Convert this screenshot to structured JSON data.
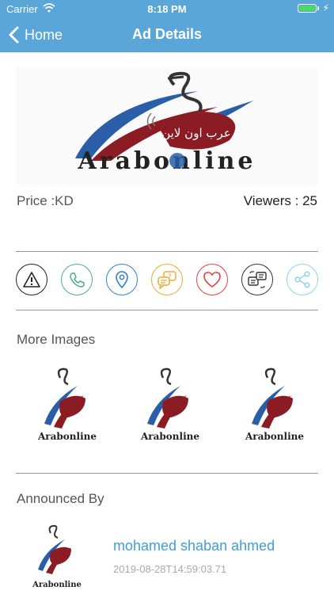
{
  "status_bar": {
    "carrier": "Carrier",
    "time": "8:18 PM"
  },
  "nav": {
    "back_label": "Home",
    "title": "Ad Details"
  },
  "ad": {
    "price_label": "Price :KD",
    "viewers_label": "Viewers : 25",
    "logo_text": "Arabonline",
    "logo_arabic": "عرب اون لاين"
  },
  "actions": [
    {
      "name": "report-icon",
      "color": "#222222"
    },
    {
      "name": "phone-icon",
      "color": "#4caf7d"
    },
    {
      "name": "location-icon",
      "color": "#2f7fd3"
    },
    {
      "name": "question-chat-icon",
      "color": "#f0a830"
    },
    {
      "name": "heart-icon",
      "color": "#e64040"
    },
    {
      "name": "exchange-icon",
      "color": "#333333"
    },
    {
      "name": "share-icon",
      "color": "#8fd3ea"
    }
  ],
  "more_images": {
    "title": "More Images",
    "count": 3
  },
  "announced_by": {
    "title": "Announced By",
    "username": "mohamed shaban ahmed",
    "date": "2019-08-28T14:59:03.71"
  },
  "colors": {
    "header": "#5aa6d9",
    "logo_blue": "#2a5ea8",
    "logo_red": "#8b1c24"
  }
}
